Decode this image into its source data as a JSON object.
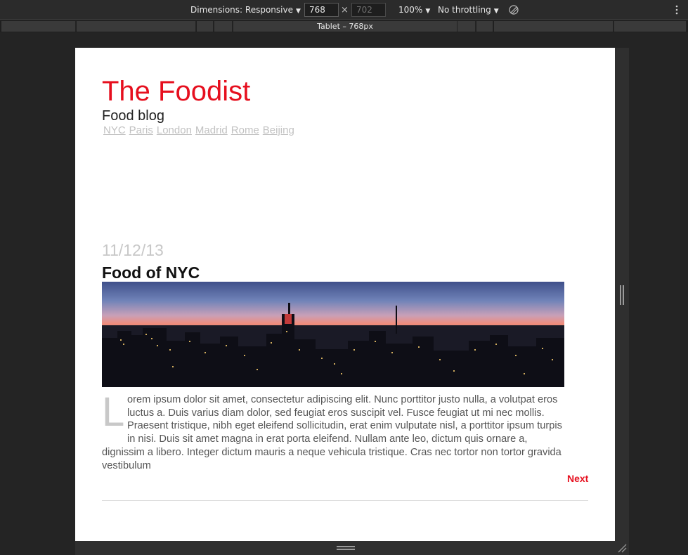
{
  "devtools": {
    "dimensions_label": "Dimensions: Responsive",
    "width_value": "768",
    "height_value": "702",
    "times_symbol": "×",
    "zoom_label": "100%",
    "throttling_label": "No throttling",
    "caret": "▼",
    "media_query_label": "Tablet – 768px",
    "icons": [
      "rotate-icon",
      "kebab-menu-icon"
    ]
  },
  "site": {
    "title": "The Foodist",
    "tagline": "Food blog",
    "nav": [
      "NYC",
      "Paris",
      "London",
      "Madrid",
      "Rome",
      "Beijing"
    ],
    "accent_color": "#e60f1e"
  },
  "post": {
    "date": "11/12/13",
    "title": "Food of NYC",
    "dropcap": "L",
    "body": "orem ipsum dolor sit amet, consectetur adipiscing elit. Nunc porttitor justo nulla, a volutpat eros luctus a. Duis varius diam dolor, sed feugiat eros suscipit vel. Fusce feugiat ut mi nec mollis. Praesent tristique, nibh eget eleifend sollicitudin, erat enim vulputate nisl, a porttitor ipsum turpis in nisi. Duis sit amet magna in erat porta eleifend. Nullam ante leo, dictum quis ornare a, dignissim a libero. Integer dictum mauris a neque vehicula tristique. Cras nec tortor non tortor gravida vestibulum",
    "next_label": "Next"
  }
}
